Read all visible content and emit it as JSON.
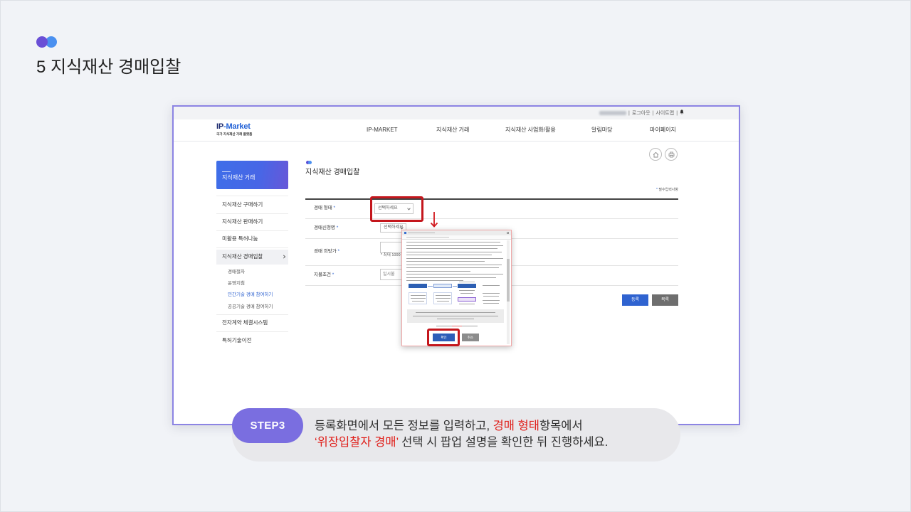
{
  "slide": {
    "title": "5 지식재산 경매입찰",
    "step_label": "STEP3",
    "instruction": {
      "line1_before": "등록화면에서 모든 정보를 입력하고, ",
      "line1_highlight": "경매 형태",
      "line1_after": "항목에서",
      "line2_highlight": "‘위장입찰자 경매’",
      "line2_after": " 선택 시 팝업 설명을 확인한 뒤 진행하세요."
    }
  },
  "site": {
    "utility": {
      "separator": "|",
      "logout": "로그아웃",
      "sitemap": "사이트맵"
    },
    "logo": {
      "mark": "IP",
      "name": "-Market",
      "tagline": "국가 지식재산 거래 플랫폼"
    },
    "nav": [
      "IP-MARKET",
      "지식재산 거래",
      "지식재산 사업화/활용",
      "알림마당",
      "마이페이지"
    ],
    "sidebar": {
      "header": "지식재산 거래",
      "items": [
        "지식재산 구매하기",
        "지식재산 판매하기",
        "미활용 특허나눔",
        "지식재산 경매입찰",
        "전자계약 체결시스템",
        "특허기술이전"
      ],
      "active_item_index": 3,
      "sub_items": [
        "경매절차",
        "운영지침",
        "민간기술 경매 참여하기",
        "공공기술 경매 참여하기"
      ],
      "active_sub_item_index": 2
    },
    "page": {
      "title": "지식재산 경매입찰",
      "required_mark": "*",
      "required_note": "필수입력사항",
      "form": {
        "rows": [
          {
            "label": "경매 형태",
            "value": "선택하세요"
          },
          {
            "label": "경매신청명",
            "value": "선택하세요"
          },
          {
            "label": "경매 희망가",
            "hint": "* 최대 1000"
          },
          {
            "label": "지불조건",
            "value": "일시불"
          }
        ]
      },
      "buttons": {
        "register": "등록",
        "list": "목록"
      }
    },
    "popup": {
      "confirm": "확인",
      "cancel": "취소"
    }
  },
  "icons": {
    "notification": "bell-icon",
    "home": "home-icon",
    "print": "print-icon",
    "select_arrow": "chevron-down-icon",
    "sidebar_chevron": "chevron-right-icon",
    "annotation_arrow": "arrow-down-icon"
  },
  "colors": {
    "slide_bg": "#f1f3f7",
    "step_accent": "#7a6ee0",
    "title_dot_purple": "#6a4fd6",
    "title_dot_blue": "#4a90f0",
    "highlight_red": "#e0201b",
    "frame_border": "#8c84e3",
    "site_primary": "#2f63d0",
    "button_gray": "#6e6e6e"
  }
}
